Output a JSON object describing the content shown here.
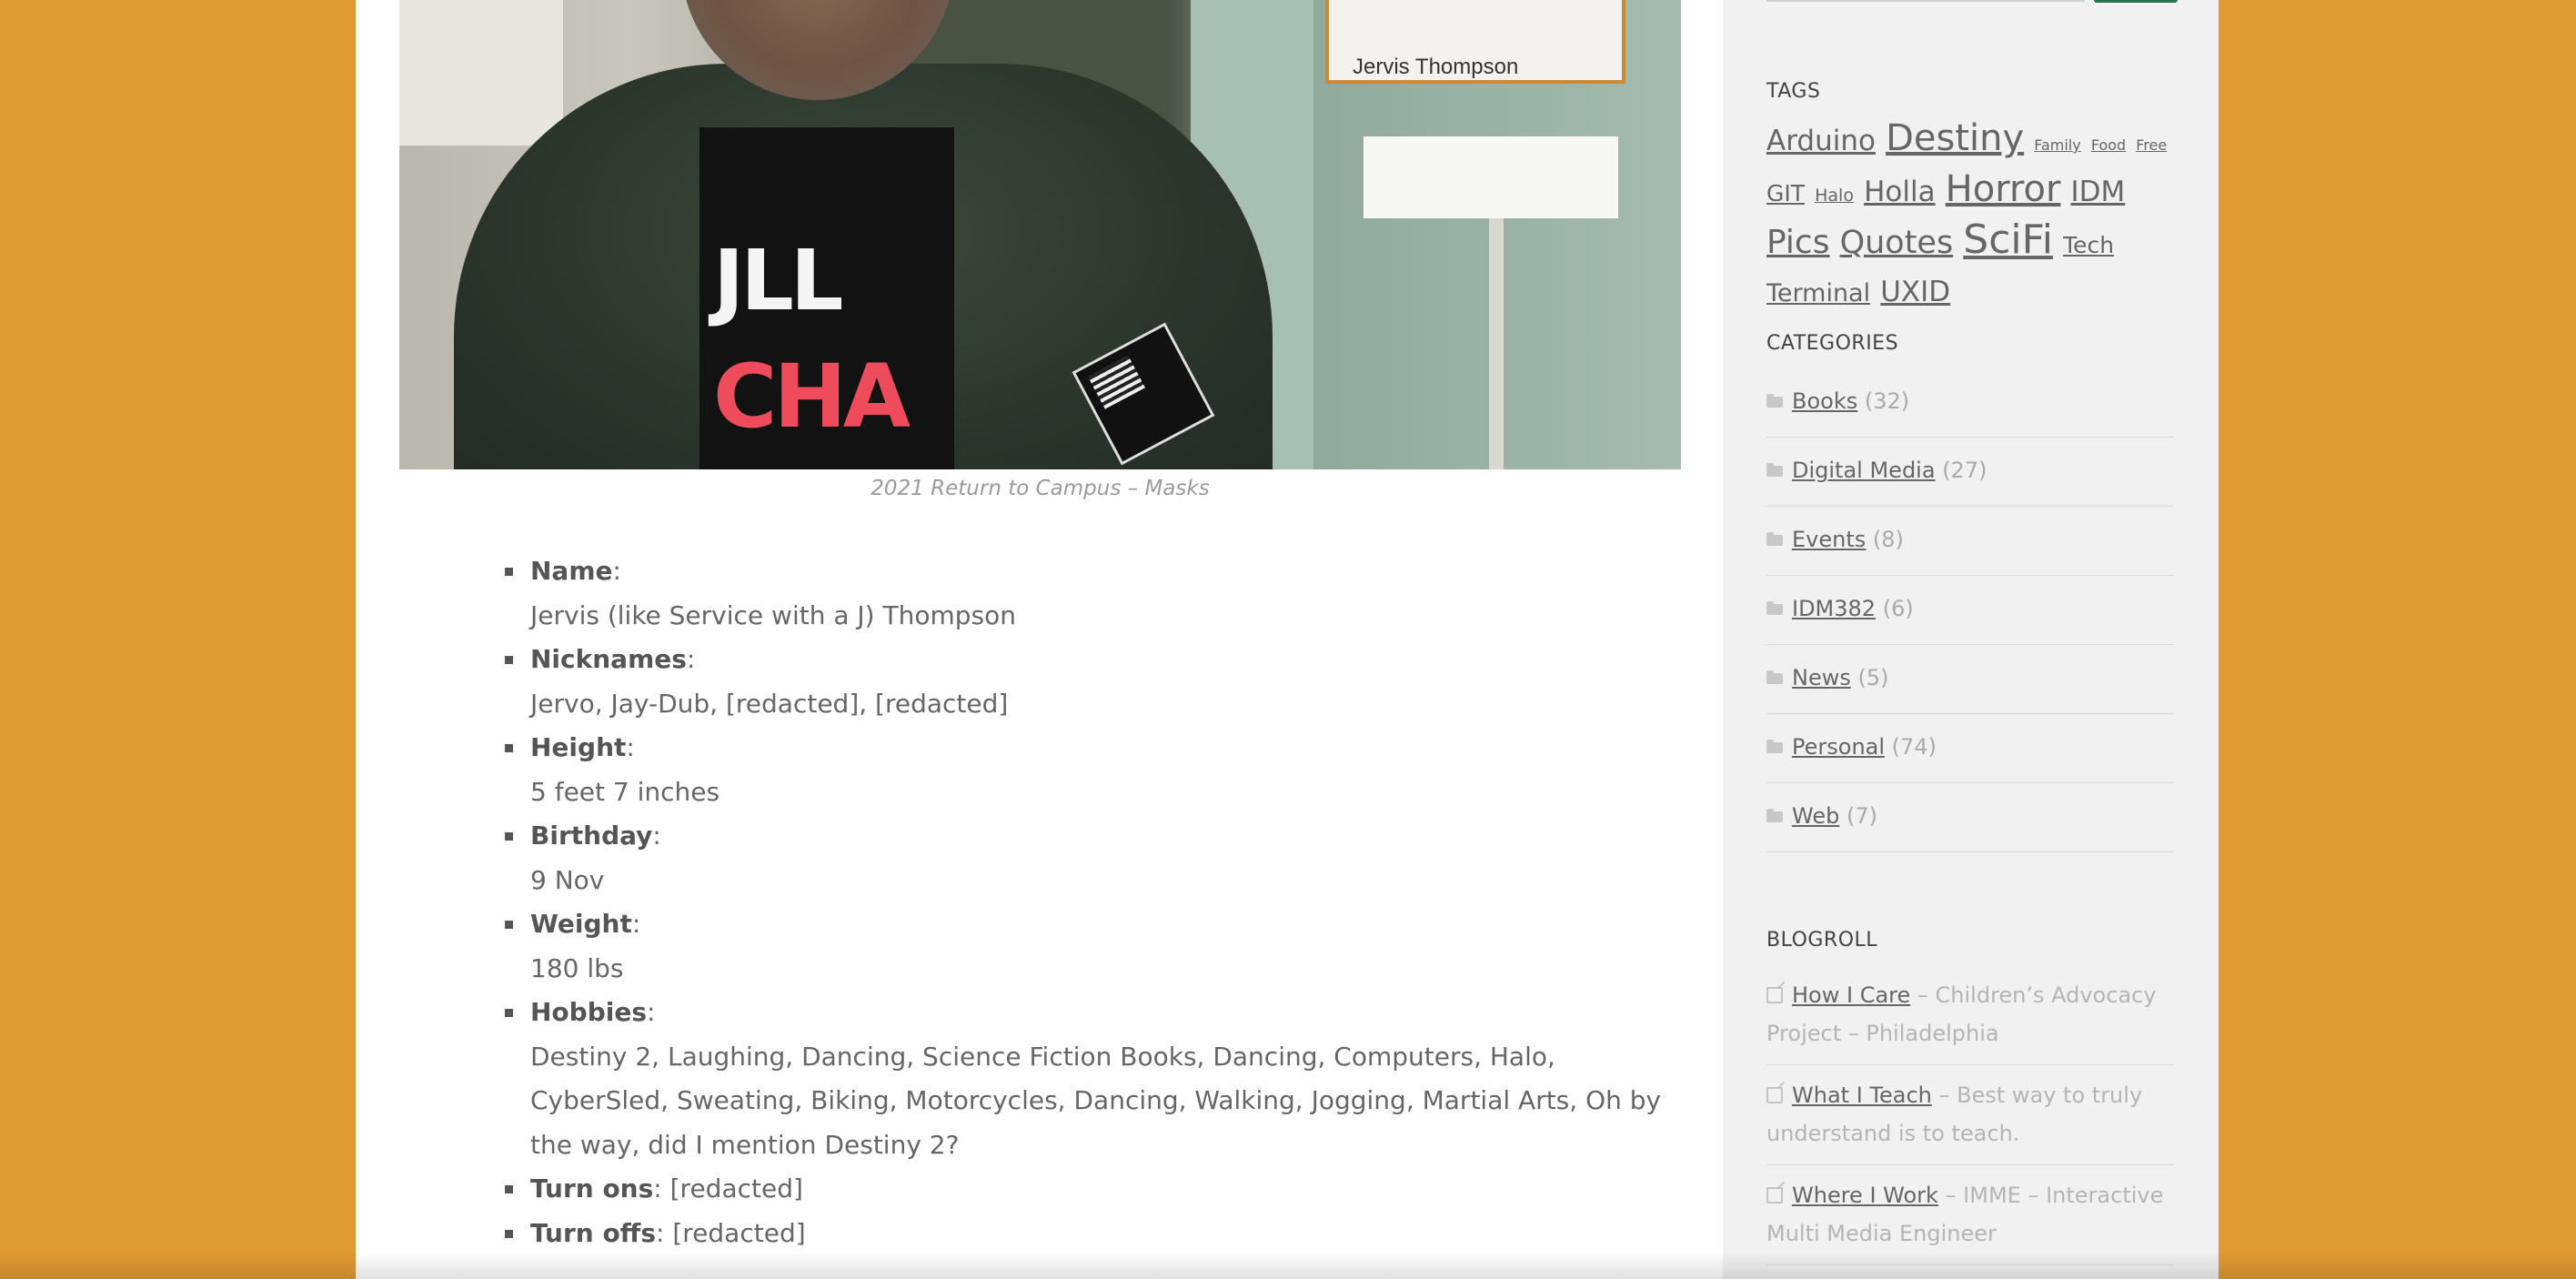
{
  "post": {
    "photo_sign_text": "Jervis Thompson",
    "photo_shirt_text_top": "JLL",
    "photo_shirt_text_bottom": "CHA",
    "caption": "2021 Return to Campus – Masks",
    "details": [
      {
        "key": "Name",
        "sep": ":",
        "value": "Jervis (like Service with a J) Thompson"
      },
      {
        "key": "Nicknames",
        "sep": ":",
        "value": "Jervo, Jay-Dub, [redacted], [redacted]"
      },
      {
        "key": "Height",
        "sep": ":",
        "value": "5 feet 7 inches"
      },
      {
        "key": "Birthday",
        "sep": ":",
        "value": "9 Nov"
      },
      {
        "key": "Weight",
        "sep": ":",
        "value": "180 lbs"
      },
      {
        "key": "Hobbies",
        "sep": ":",
        "value": "Destiny 2, Laughing, Dancing, Science Fiction Books, Dancing, Computers, Halo, CyberSled, Sweating, Biking, Motorcycles, Dancing, Walking, Jogging, Martial Arts, Oh by the way, did I mention Destiny 2?"
      },
      {
        "key": "Turn ons",
        "sep": ": [redacted]",
        "value": ""
      },
      {
        "key": "Turn offs",
        "sep": ": [redacted]",
        "value": ""
      }
    ]
  },
  "sidebar": {
    "tags_title": "TAGS",
    "tags": [
      {
        "label": "Arduino",
        "size": 31
      },
      {
        "label": "Destiny",
        "size": 40
      },
      {
        "label": "Family",
        "size": 16
      },
      {
        "label": "Food",
        "size": 16
      },
      {
        "label": "Free",
        "size": 16
      },
      {
        "label": "GIT",
        "size": 25
      },
      {
        "label": "Halo",
        "size": 19
      },
      {
        "label": "Holla",
        "size": 31
      },
      {
        "label": "Horror",
        "size": 40
      },
      {
        "label": "IDM",
        "size": 31
      },
      {
        "label": "Pics",
        "size": 36
      },
      {
        "label": "Quotes",
        "size": 35
      },
      {
        "label": "SciFi",
        "size": 44
      },
      {
        "label": "Tech",
        "size": 25
      },
      {
        "label": "Terminal",
        "size": 27
      },
      {
        "label": "UXID",
        "size": 31
      }
    ],
    "categories_title": "CATEGORIES",
    "categories": [
      {
        "label": "Books",
        "count": "(32)"
      },
      {
        "label": "Digital Media",
        "count": "(27)"
      },
      {
        "label": "Events",
        "count": "(8)"
      },
      {
        "label": "IDM382",
        "count": "(6)"
      },
      {
        "label": "News",
        "count": "(5)"
      },
      {
        "label": "Personal",
        "count": "(74)"
      },
      {
        "label": "Web",
        "count": "(7)"
      }
    ],
    "blogroll_title": "BLOGROLL",
    "blogroll": [
      {
        "label": "How I Care",
        "desc": " – Children’s Advocacy Project – Philadelphia"
      },
      {
        "label": "What I Teach",
        "desc": " – Best way to truly understand is to teach."
      },
      {
        "label": "Where I Work",
        "desc": " – IMME – Interactive Multi Media Engineer"
      }
    ]
  }
}
